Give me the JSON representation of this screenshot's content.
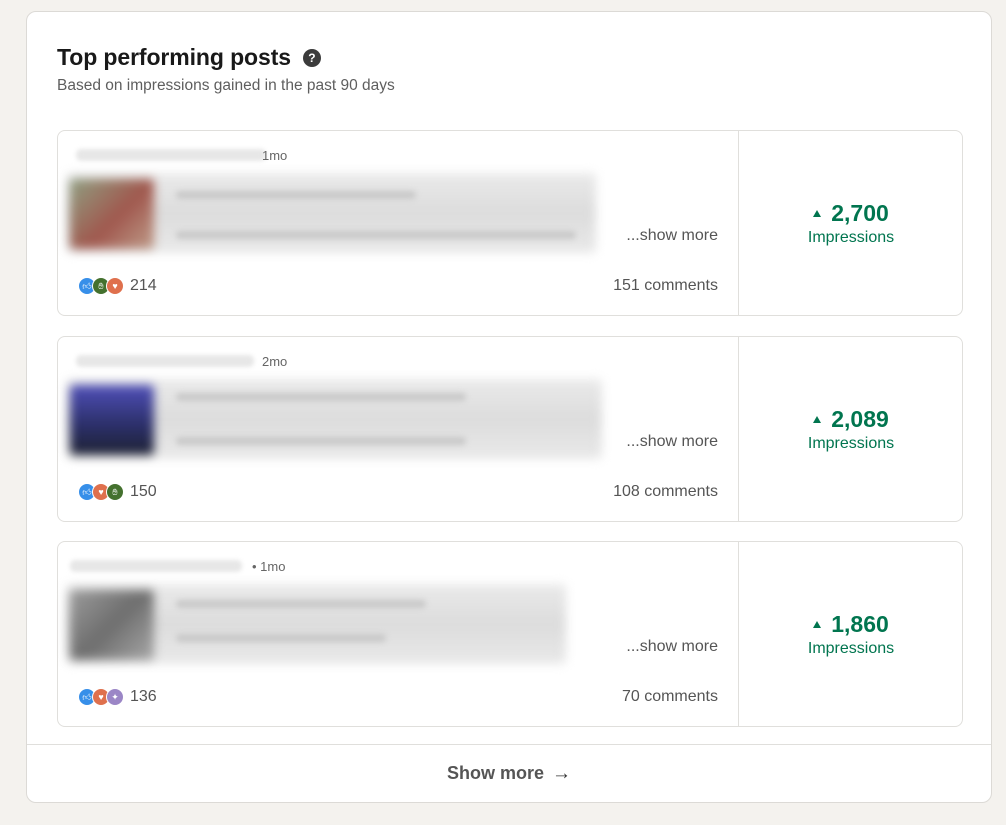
{
  "header": {
    "title": "Top performing posts",
    "help_icon": "help-circle-icon",
    "subtitle": "Based on impressions gained in the past 90 days"
  },
  "posts": [
    {
      "time": "1mo",
      "show_more": "...show more",
      "reaction_icons": [
        "like-icon",
        "celebrate-icon",
        "love-icon"
      ],
      "reaction_count": "214",
      "comments": "151 comments",
      "impressions_value": "2,700",
      "impressions_label": "Impressions"
    },
    {
      "time": "2mo",
      "show_more": "...show more",
      "reaction_icons": [
        "like-icon",
        "love-icon",
        "celebrate-icon"
      ],
      "reaction_count": "150",
      "comments": "108 comments",
      "impressions_value": "2,089",
      "impressions_label": "Impressions"
    },
    {
      "time": "• 1mo",
      "show_more": "...show more",
      "reaction_icons": [
        "like-icon",
        "love-icon",
        "support-icon"
      ],
      "reaction_count": "136",
      "comments": "70 comments",
      "impressions_value": "1,860",
      "impressions_label": "Impressions"
    }
  ],
  "footer": {
    "label": "Show more",
    "icon": "arrow-right-icon"
  },
  "colors": {
    "impressions_green": "#01754f",
    "page_bg": "#f4f2ee"
  }
}
